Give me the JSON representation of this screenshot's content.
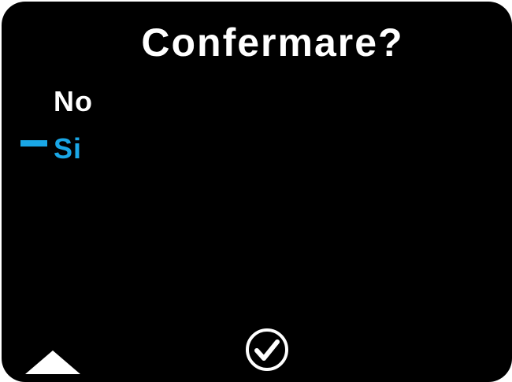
{
  "screen": {
    "title": "Confermare?",
    "options": [
      {
        "label": "No",
        "selected": false
      },
      {
        "label": "Si",
        "selected": true
      }
    ],
    "footer": {
      "left_icon": "triangle-up-icon",
      "center_icon": "checkmark-circle-icon"
    }
  },
  "colors": {
    "background": "#000000",
    "text": "#ffffff",
    "accent": "#1aa7e6"
  }
}
